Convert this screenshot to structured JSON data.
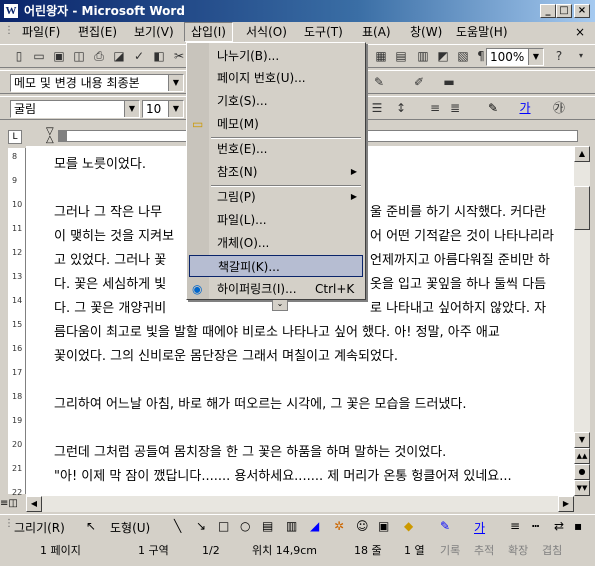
{
  "window": {
    "title": "어린왕자 - Microsoft Word",
    "app_icon": "W"
  },
  "menubar": [
    "파일(F)",
    "편집(E)",
    "보기(V)",
    "삽입(I)",
    "서식(O)",
    "도구(T)",
    "표(A)",
    "창(W)",
    "도움말(H)"
  ],
  "menubar_help_close": "×",
  "toolbar": {
    "zoom": "100%",
    "help_glyph": "?",
    "style": "메모 및 변경 내용 최종본",
    "font": "굴림",
    "size": "10"
  },
  "insert_menu": [
    {
      "label": "나누기(B)..."
    },
    {
      "label": "페이지 번호(U)..."
    },
    {
      "label": "기호(S)..."
    },
    {
      "label": "메모(M)"
    },
    {
      "label": "번호(E)..."
    },
    {
      "label": "참조(N)",
      "submenu": true
    },
    {
      "label": "그림(P)",
      "submenu": true
    },
    {
      "label": "파일(L)..."
    },
    {
      "label": "개체(O)..."
    },
    {
      "label": "책갈피(K)...",
      "highlighted": true
    },
    {
      "label": "하이퍼링크(I)...",
      "shortcut": "Ctrl+K"
    }
  ],
  "document": {
    "lines": [
      "모를 노릇이었다.",
      "",
      "그러나 그 작은 나무",
      "이 맺히는 것을 지켜보",
      "고 있었다. 그러나 꽃",
      "다. 꽃은 세심하게 빛",
      "다. 그 꽃은 개양귀비",
      "름다움이 최고로 빛을 발할 때에야 비로소 나타나고 싶어 했다. 아! 정말, 아주 애교",
      "꽃이었다. 그의 신비로운 몸단장은 그래서 며칠이고 계속되었다.",
      "",
      "그리하여 어느날 아침, 바로 해가 떠오르는 시각에, 그 꽃은 모습을 드러냈다.",
      "",
      "그런데 그처럼 공들여 몸치장을 한 그 꽃은 하품을 하며 말하는 것이었다.",
      "\"아! 이제 막 잠이 깼답니다....... 용서하세요....... 제 머리가 온통 헝클어져 있네요..."
    ],
    "right_fragments": [
      {
        "row": 2,
        "text": "울 준비를 하기 시작했다. 커다란"
      },
      {
        "row": 3,
        "text": "어 어떤 기적같은 것이 나타나리라"
      },
      {
        "row": 4,
        "text": "언제까지고 아름다워질 준비만 하"
      },
      {
        "row": 5,
        "text": "옷을 입고 꽃잎을 하나 둘씩 다듬"
      },
      {
        "row": 6,
        "text": "로 나타내고 싶어하지 않았다. 자"
      }
    ]
  },
  "drawbar": {
    "draw": "그리기(R)",
    "shapes": "도형(U)"
  },
  "statusbar": {
    "page": "1 페이지",
    "section": "1 구역",
    "pages": "1/2",
    "position": "위치 14,9cm",
    "line": "18 줄",
    "col": "1 열",
    "modes": [
      "기록",
      "추적",
      "확장",
      "겹침"
    ]
  }
}
